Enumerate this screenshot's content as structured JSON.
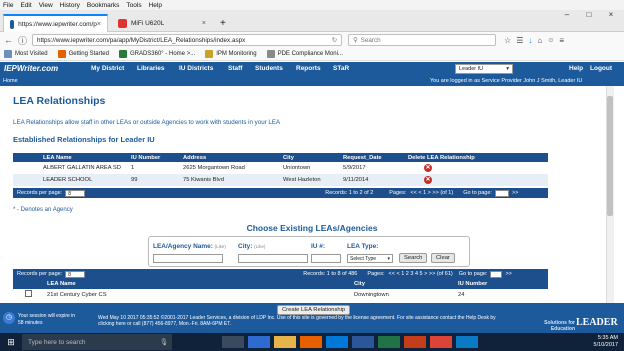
{
  "browser": {
    "menu": [
      "File",
      "Edit",
      "View",
      "History",
      "Bookmarks",
      "Tools",
      "Help"
    ],
    "tabs": [
      {
        "title": "https://www.iepwriter.com/p"
      },
      {
        "title": "MiFi U620L"
      }
    ],
    "url": "https://www.iepwriter.com/pa/app/MyDistrict/LEA_Relationships/index.aspx",
    "search_placeholder": "Search",
    "bookmarks": [
      "Most Visited",
      "Getting Started",
      "GRADS360° - Home >...",
      "IPM Monitoring",
      "PDE Compliance Moni..."
    ]
  },
  "app": {
    "logo": "IEPWriter.com",
    "nav": [
      "My District",
      "Libraries",
      "IU Districts",
      "Staff",
      "Students",
      "Reports",
      "STaR"
    ],
    "org_select": "Leader IU",
    "right_links": [
      "Help",
      "Logout"
    ],
    "breadcrumb": "Home",
    "logged_in": "You are logged in as  Service Provider John J Smith, Leader IU"
  },
  "page": {
    "title": "LEA Relationships",
    "description": "LEA Relationships allow staff in other LEAs or outside Agencies to work with students in your LEA",
    "established_title": "Established Relationships for Leader IU",
    "note": "* - Denotes an Agency",
    "choose_title": "Choose Existing LEAs/Agencies"
  },
  "established": {
    "headers": [
      "LEA Name",
      "IU Number",
      "Address",
      "City",
      "Request_Date",
      "Delete LEA Relationship"
    ],
    "rows": [
      {
        "name": "ALBERT GALLATIN AREA SD",
        "iu": "1",
        "address": "2625 Morgantown Road",
        "city": "Uniontown",
        "date": "5/9/2017"
      },
      {
        "name": "LEADER SCHOOL",
        "iu": "99",
        "address": "75 Kiwanis Blvd",
        "city": "West Hazleton",
        "date": "9/11/2014"
      }
    ],
    "pager": {
      "records_label": "Records per page:",
      "records_value": "8",
      "records_info": "Records: 1 to 2 of 2",
      "pages_label": "Pages:",
      "pages_nav": "<<  <  1  >  >>  (of 1)",
      "goto_label": "Go to page:",
      "go": ">>"
    }
  },
  "filters": {
    "agency_label": "LEA/Agency Name:",
    "agency_hint": "(Like)",
    "city_label": "City:",
    "city_hint": "(Like)",
    "iu_label": "IU #:",
    "type_label": "LEA Type:",
    "type_value": "Select Type",
    "search_btn": "Search",
    "clear_btn": "Clear"
  },
  "existing": {
    "pager": {
      "records_label": "Records per page:",
      "records_value": "8",
      "records_info": "Records: 1 to 8 of 486",
      "pages_label": "Pages:",
      "pages_nav": "<<  <  1  2  3  4  5  >  >>  (of 61)",
      "goto_label": "Go to page:",
      "go": ">>"
    },
    "headers": [
      "LEA Name",
      "City",
      "IU Number"
    ],
    "rows": [
      {
        "name": "21st Century Cyber CS",
        "city": "Downingtown",
        "iu": "24"
      }
    ]
  },
  "footer": {
    "session": "Your session will expire in 58 minutes",
    "create_btn": "Create LEA Relationship",
    "copyright": "Wed May 10 2017 05:35:52 ©2001-2017 Leader Services, a division of LDP Inc. Use of this site is governed by the license agreement. For site assistance contact the Help Desk by clicking here or call (877) 456-8977, Mon.-Fri. 8AM-6PM ET.",
    "brand_tag": "Solutions for Education",
    "brand": "LEADER"
  },
  "taskbar": {
    "search": "Type here to search",
    "time": "5:35 AM",
    "date": "5/10/2017"
  },
  "colors": {
    "brand": "#1d5a9c",
    "grid_header": "#1d4f8c",
    "delete": "#c0302b"
  }
}
